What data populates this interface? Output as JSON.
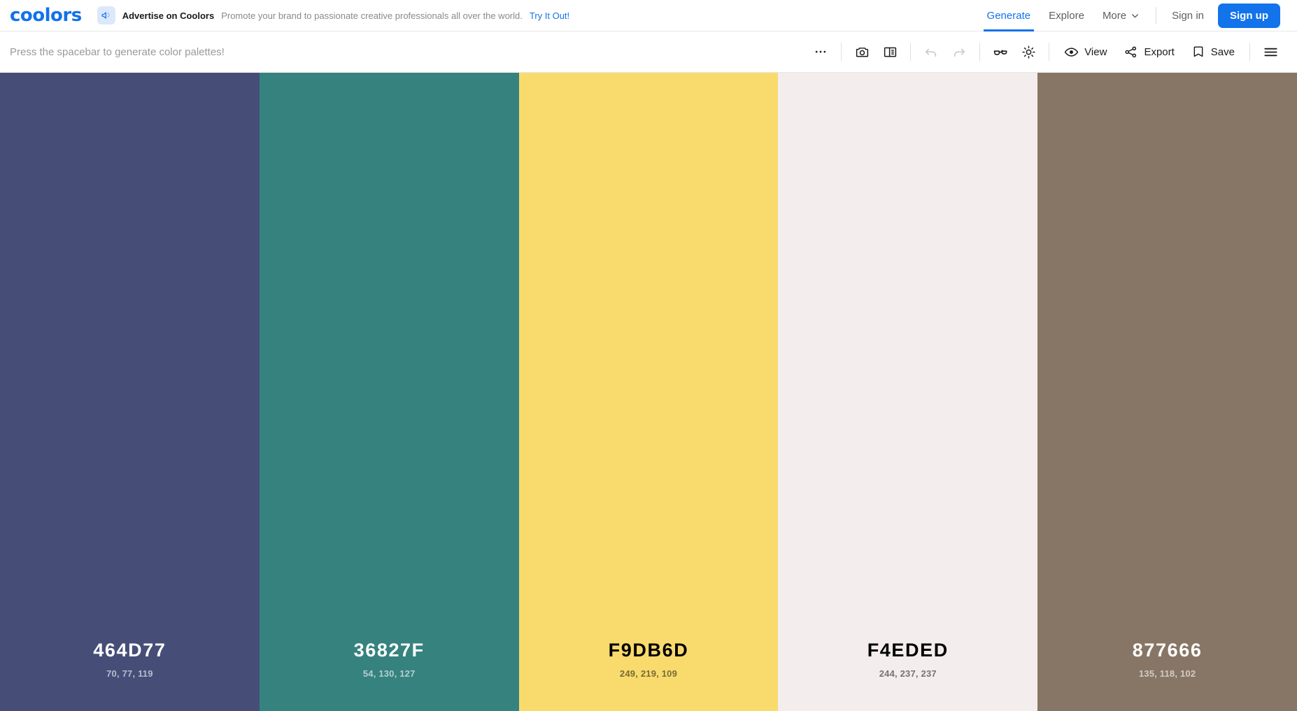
{
  "header": {
    "logo": "coolors",
    "ad": {
      "icon": "megaphone-icon",
      "title": "Advertise on Coolors",
      "text": "Promote your brand to passionate creative professionals all over the world.",
      "cta": "Try It Out!"
    },
    "nav": [
      {
        "label": "Generate",
        "active": true
      },
      {
        "label": "Explore",
        "active": false
      },
      {
        "label": "More",
        "active": false,
        "chevron": "chevron-down-icon"
      }
    ],
    "sign_in": "Sign in",
    "sign_up": "Sign up",
    "accent_color": "#1273EB"
  },
  "toolbar": {
    "hint": "Press the spacebar to generate color palettes!",
    "icon_buttons": [
      {
        "name": "more-options-icon",
        "label": "More options",
        "disabled": false
      },
      {
        "name": "camera-icon",
        "label": "Screenshot",
        "disabled": false
      },
      {
        "name": "layout-panel-icon",
        "label": "Layout",
        "disabled": false
      },
      {
        "name": "undo-icon",
        "label": "Undo",
        "disabled": true
      },
      {
        "name": "redo-icon",
        "label": "Redo",
        "disabled": true
      },
      {
        "name": "glasses-icon",
        "label": "Color blindness",
        "disabled": false
      },
      {
        "name": "brightness-icon",
        "label": "Adjust",
        "disabled": false
      }
    ],
    "view_label": "View",
    "export_label": "Export",
    "save_label": "Save",
    "menu_label": "Menu"
  },
  "palette": {
    "swatches": [
      {
        "hex": "464D77",
        "rgb": "70, 77, 119",
        "css": "#464D77",
        "text": "light"
      },
      {
        "hex": "36827F",
        "rgb": "54, 130, 127",
        "css": "#36827F",
        "text": "light"
      },
      {
        "hex": "F9DB6D",
        "rgb": "249, 219, 109",
        "css": "#F9DB6D",
        "text": "dark"
      },
      {
        "hex": "F4EDED",
        "rgb": "244, 237, 237",
        "css": "#F4EDED",
        "text": "dark"
      },
      {
        "hex": "877666",
        "rgb": "135, 118, 102",
        "css": "#877666",
        "text": "light"
      }
    ]
  }
}
